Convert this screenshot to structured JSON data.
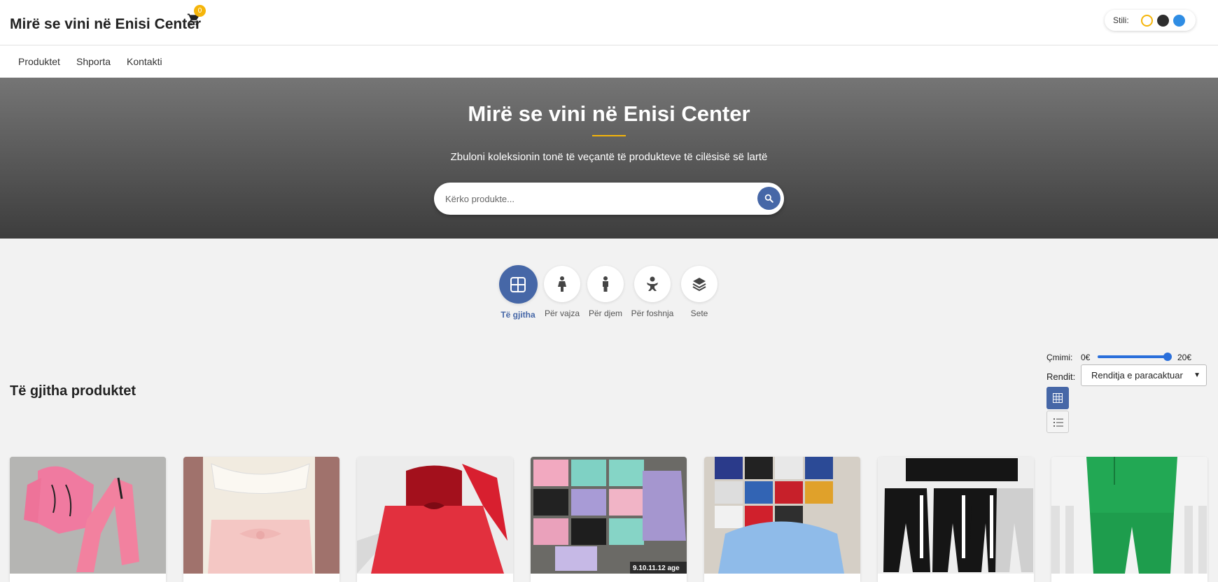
{
  "header": {
    "brand": "Mirë se vini në Enisi Center",
    "cart_count": "0",
    "style_label": "Stili:",
    "style_colors": [
      "#f5b50a",
      "#2e2e2e",
      "#2f8de4"
    ]
  },
  "nav": {
    "items": [
      {
        "label": "Produktet"
      },
      {
        "label": "Shporta"
      },
      {
        "label": "Kontakti"
      }
    ]
  },
  "hero": {
    "title": "Mirë se vini në Enisi Center",
    "subtitle": "Zbuloni koleksionin tonë të veçantë të produkteve të cilësisë së lartë",
    "search_placeholder": "Kërko produkte...",
    "accent": "#f5b50a"
  },
  "categories": [
    {
      "label": "Të gjitha",
      "icon": "grid-icon",
      "active": true
    },
    {
      "label": "Për vajza",
      "icon": "girl-icon",
      "active": false
    },
    {
      "label": "Për djem",
      "icon": "boy-icon",
      "active": false
    },
    {
      "label": "Për foshnja",
      "icon": "baby-icon",
      "active": false
    },
    {
      "label": "Sete",
      "icon": "layers-icon",
      "active": false
    }
  ],
  "products": {
    "title": "Të gjitha produktet",
    "price_label": "Çmimi:",
    "price_min": "0€",
    "price_max": "20€",
    "price_value": 1.0,
    "sort_label": "Rendit:",
    "sort_value": "Renditja e paracaktuar",
    "view_mode": "grid",
    "items": [
      {
        "image": "pink tracksuit"
      },
      {
        "image": "white and pink dress"
      },
      {
        "image": "red tulle dress"
      },
      {
        "image": "printed sweatshirts",
        "overlay_text": "9.10.11.12 age"
      },
      {
        "image": "sweatshirts set"
      },
      {
        "image": "black sweatpants"
      },
      {
        "image": "green tracksuit"
      }
    ]
  },
  "colors": {
    "primary": "#4667a7",
    "accent": "#f5b50a"
  }
}
